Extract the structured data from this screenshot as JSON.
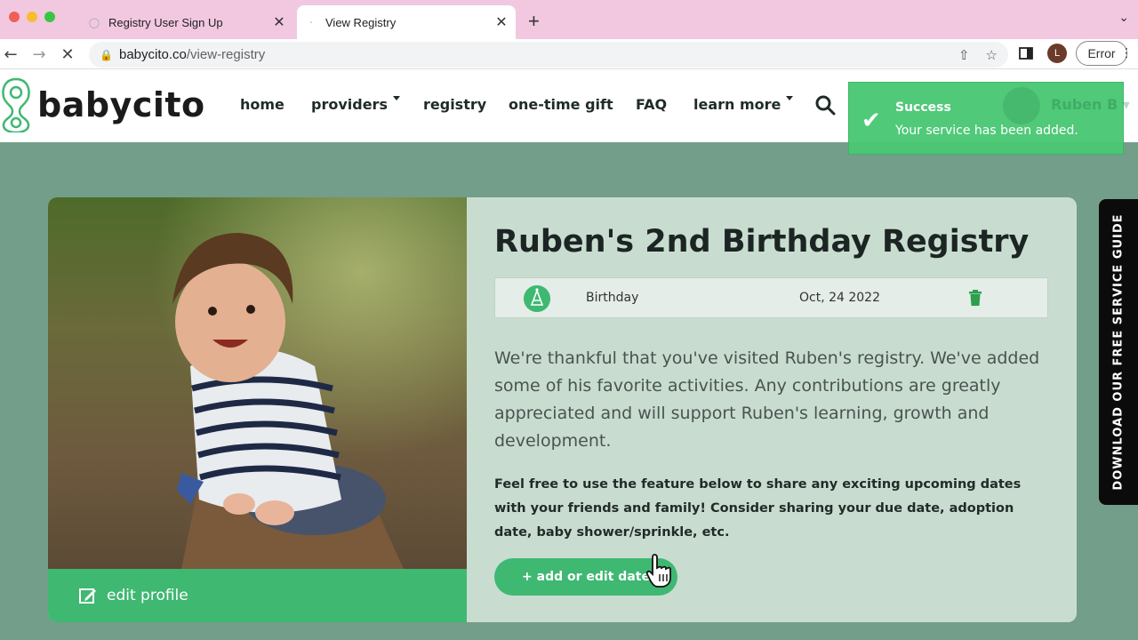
{
  "browser": {
    "tabs": [
      {
        "label": "Registry User Sign Up",
        "active": false
      },
      {
        "label": "View Registry",
        "active": true
      }
    ],
    "url_host": "babycito.co",
    "url_path": "/view-registry",
    "profile_initial": "L",
    "status_chip": "Error"
  },
  "site": {
    "logo_text": "babycito",
    "nav": [
      "home",
      "providers",
      "registry",
      "one-time gift",
      "FAQ",
      "learn more"
    ],
    "user_name": "Ruben B"
  },
  "toast": {
    "title": "Success",
    "message": "Your service has been added."
  },
  "registry": {
    "title": "Ruben's 2nd Birthday Registry",
    "event_type": "Birthday",
    "event_date": "Oct, 24 2022",
    "description": "We're thankful that you've visited Ruben's registry.  We've added some of his favorite activities.  Any contributions are greatly appreciated and will support Ruben's learning, growth and development.",
    "share_text": "Feel free to use the feature below to share any exciting upcoming dates with your friends and family! Consider sharing your due date, adoption date, baby shower/sprinkle, etc.",
    "add_date_label": "+ add or edit date",
    "edit_profile_label": "edit profile"
  },
  "side_guide": "DOWNLOAD OUR FREE SERVICE GUIDE",
  "colors": {
    "brand_green": "#3fb872",
    "page_bg": "#739e89",
    "card_bg": "#c8ddd0",
    "toast_green": "#4bc875"
  }
}
